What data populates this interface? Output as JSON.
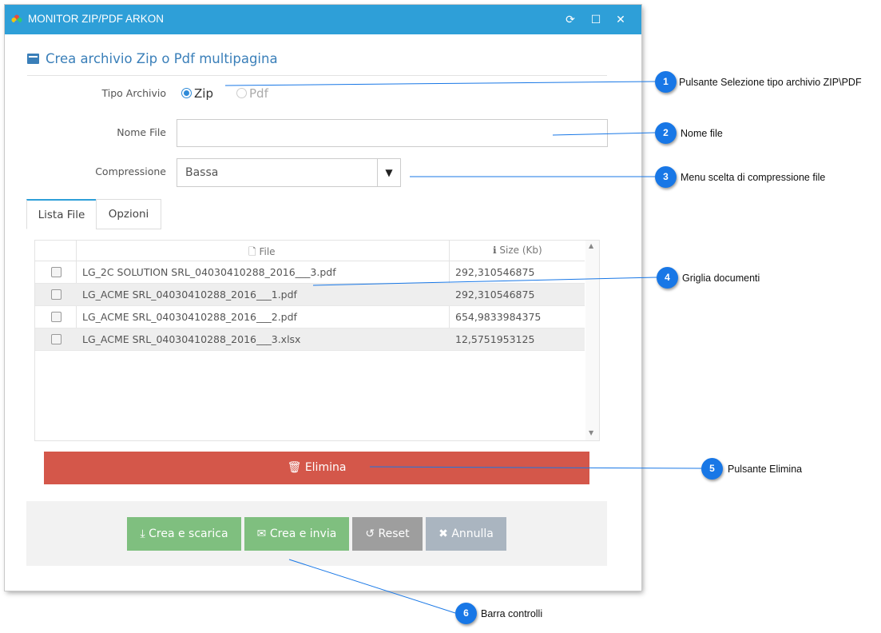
{
  "window": {
    "title": "MONITOR ZIP/PDF ARKON",
    "controls": {
      "refresh": "⟳",
      "maximize": "☐",
      "close": "✕"
    }
  },
  "header": {
    "title": "Crea archivio Zip o Pdf multipagina"
  },
  "form": {
    "archive_type_label": "Tipo Archivio",
    "options": [
      {
        "label": "Zip",
        "checked": true
      },
      {
        "label": "Pdf",
        "checked": false
      }
    ],
    "file_name_label": "Nome File",
    "file_name_value": "",
    "compression_label": "Compressione",
    "compression_value": "Bassa"
  },
  "tabs": [
    {
      "label": "Lista File",
      "active": true
    },
    {
      "label": "Opzioni",
      "active": false
    }
  ],
  "grid": {
    "columns": {
      "file": "File",
      "size": "Size (Kb)"
    },
    "rows": [
      {
        "file": "LG_2C SOLUTION SRL_04030410288_2016___3.pdf",
        "size": "292,310546875"
      },
      {
        "file": "LG_ACME SRL_04030410288_2016___1.pdf",
        "size": "292,310546875"
      },
      {
        "file": "LG_ACME SRL_04030410288_2016___2.pdf",
        "size": "654,9833984375"
      },
      {
        "file": "LG_ACME SRL_04030410288_2016___3.xlsx",
        "size": "12,5751953125"
      }
    ]
  },
  "buttons": {
    "delete": "Elimina",
    "create_download": "Crea e scarica",
    "create_send": "Crea e invia",
    "reset": "Reset",
    "cancel": "Annulla"
  },
  "colors": {
    "titlebar": "#2e9fd8",
    "delete": "#d4574a",
    "green": "#7fbf7f",
    "reset": "#9e9e9e",
    "cancel": "#aab5c0",
    "badge": "#1877e6"
  },
  "callouts": [
    {
      "number": "1",
      "text": "Pulsante Selezione tipo archivio ZIP\\PDF"
    },
    {
      "number": "2",
      "text": "Nome file"
    },
    {
      "number": "3",
      "text": "Menu scelta di compressione file"
    },
    {
      "number": "4",
      "text": "Griglia documenti"
    },
    {
      "number": "5",
      "text": "Pulsante Elimina"
    },
    {
      "number": "6",
      "text": "Barra controlli"
    }
  ]
}
